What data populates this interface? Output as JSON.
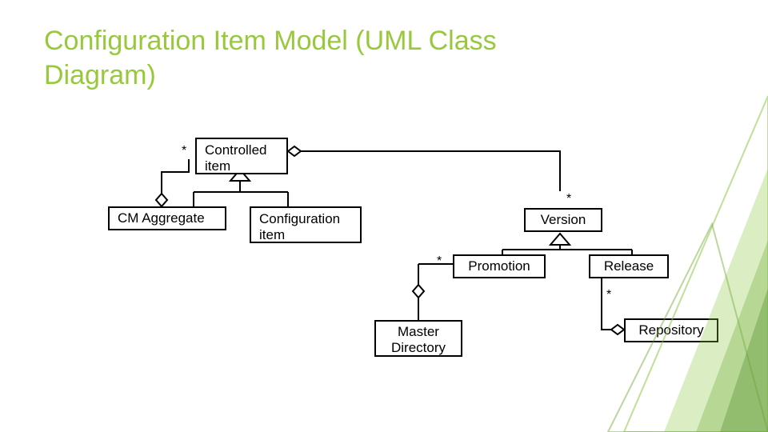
{
  "title": "Configuration Item Model (UML Class Diagram)",
  "boxes": {
    "controlled_item": "Controlled\nitem",
    "cm_aggregate": "CM Aggregate",
    "configuration_item": "Configuration\nitem",
    "version": "Version",
    "promotion": "Promotion",
    "release": "Release",
    "master_directory": "Master\nDirectory",
    "repository": "Repository"
  },
  "multiplicities": {
    "controlled_left": "*",
    "version_top": "*",
    "promotion_left": "*",
    "release_bottom": "*"
  }
}
